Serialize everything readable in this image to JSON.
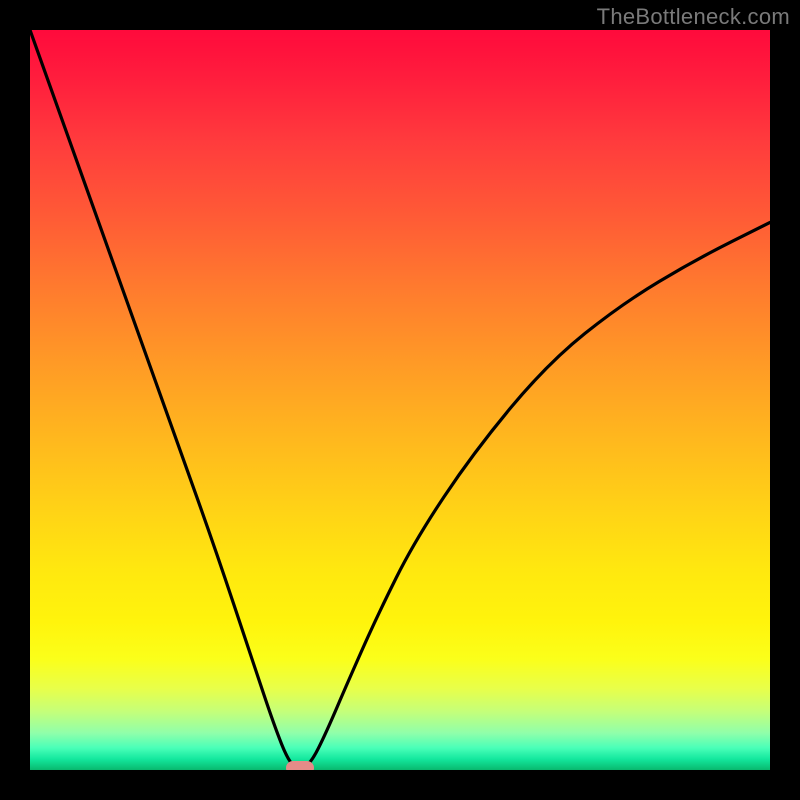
{
  "watermark": "TheBottleneck.com",
  "chart_data": {
    "type": "line",
    "title": "",
    "xlabel": "",
    "ylabel": "",
    "xlim": [
      0,
      100
    ],
    "ylim": [
      0,
      100
    ],
    "grid": false,
    "legend": false,
    "background_gradient": {
      "direction": "vertical",
      "stops": [
        {
          "pos": 0,
          "color": "#ff0a3c"
        },
        {
          "pos": 25,
          "color": "#ff5a36"
        },
        {
          "pos": 50,
          "color": "#ffb71e"
        },
        {
          "pos": 75,
          "color": "#fff40c"
        },
        {
          "pos": 95,
          "color": "#90ffaa"
        },
        {
          "pos": 100,
          "color": "#09b86e"
        }
      ]
    },
    "series": [
      {
        "name": "bottleneck-curve",
        "x": [
          0,
          5,
          10,
          15,
          20,
          25,
          30,
          33,
          35,
          36.5,
          38,
          40,
          43,
          47,
          52,
          60,
          70,
          80,
          90,
          100
        ],
        "y": [
          100,
          86,
          72,
          58,
          44,
          30,
          15,
          6,
          1,
          0,
          1,
          5,
          12,
          21,
          31,
          43,
          55,
          63,
          69,
          74
        ]
      }
    ],
    "annotations": [
      {
        "name": "optimal-marker",
        "x": 36.5,
        "y": 0,
        "color": "#e58b88"
      }
    ]
  }
}
